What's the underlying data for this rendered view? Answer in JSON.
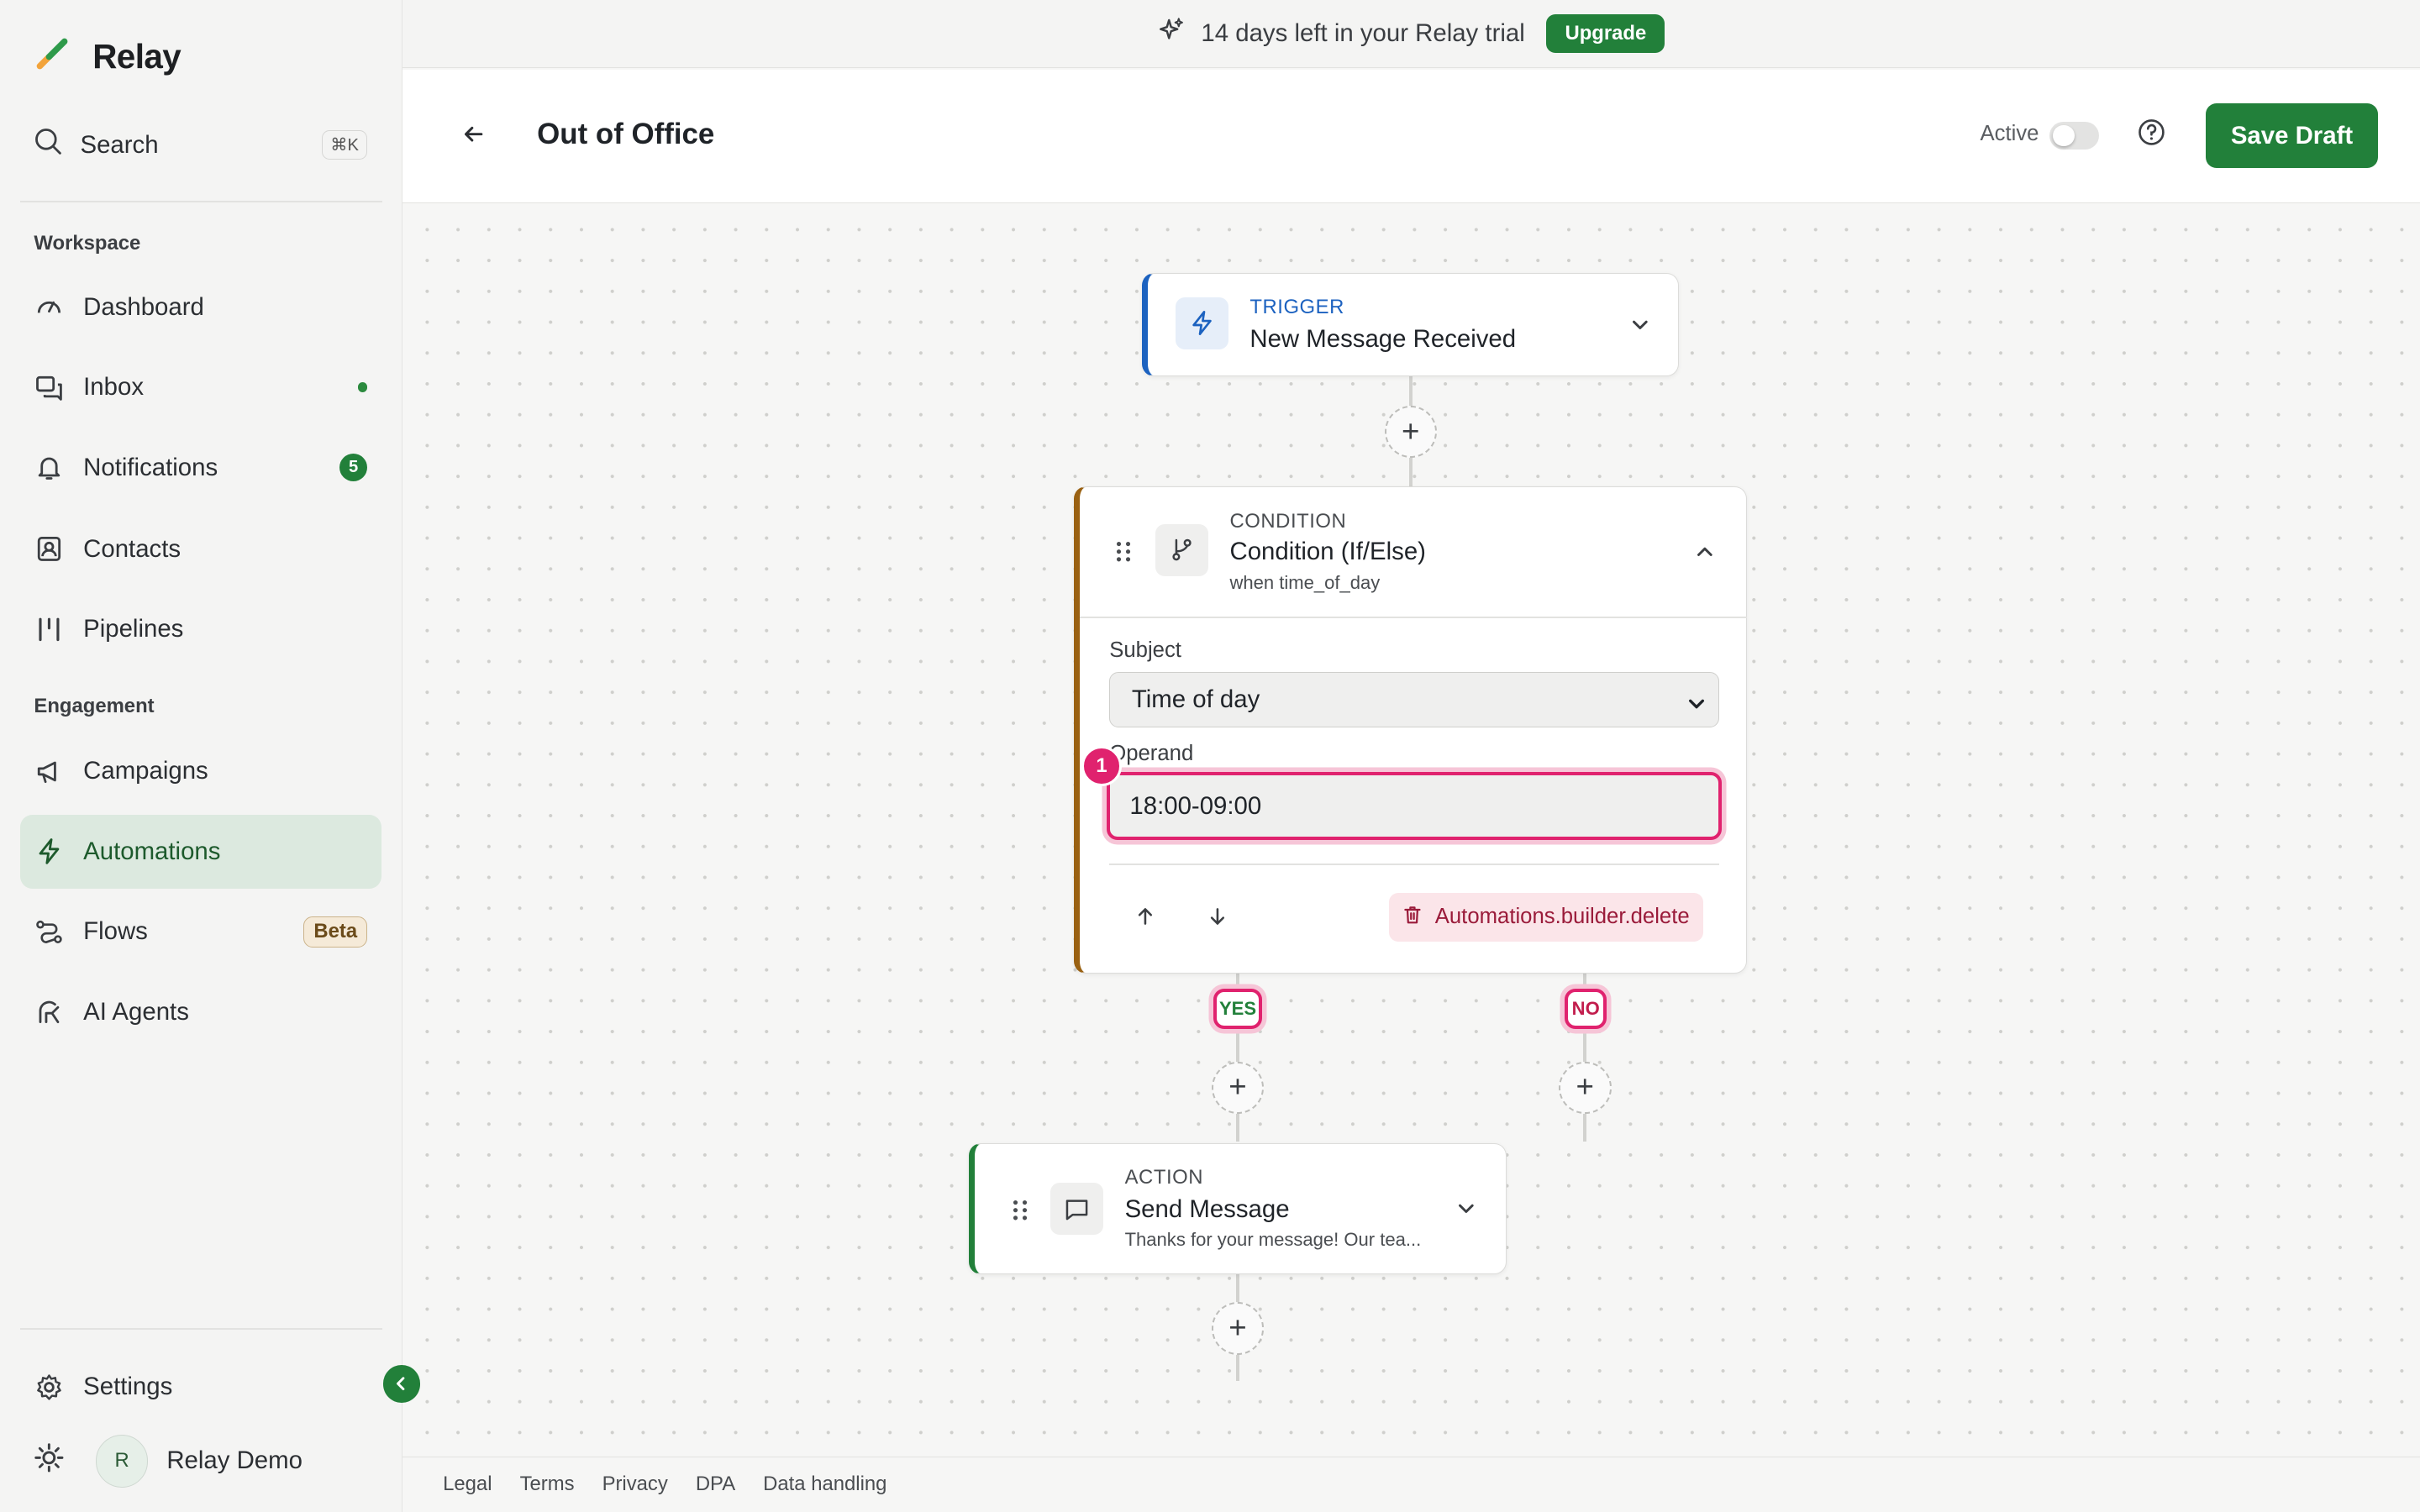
{
  "app": {
    "name": "Relay"
  },
  "banner": {
    "text": "14 days left in your Relay trial",
    "upgrade_label": "Upgrade"
  },
  "sidebar": {
    "search_label": "Search",
    "search_shortcut": "⌘K",
    "sections": {
      "workspace": "Workspace",
      "engagement": "Engagement"
    },
    "items": [
      {
        "label": "Dashboard",
        "icon": "dashboard-icon"
      },
      {
        "label": "Inbox",
        "icon": "inbox-icon",
        "unread_dot": true
      },
      {
        "label": "Notifications",
        "icon": "bell-icon",
        "badge": "5"
      },
      {
        "label": "Contacts",
        "icon": "contacts-icon"
      },
      {
        "label": "Pipelines",
        "icon": "pipelines-icon"
      },
      {
        "label": "Campaigns",
        "icon": "megaphone-icon"
      },
      {
        "label": "Automations",
        "icon": "bolt-icon",
        "active": true
      },
      {
        "label": "Flows",
        "icon": "flows-icon",
        "badge": "Beta"
      },
      {
        "label": "AI Agents",
        "icon": "ai-agent-icon"
      }
    ],
    "settings_label": "Settings",
    "user": {
      "initial": "R",
      "name": "Relay Demo"
    }
  },
  "header": {
    "title": "Out of Office",
    "active_label": "Active",
    "active": false,
    "save_label": "Save Draft"
  },
  "canvas": {
    "trigger": {
      "kind": "TRIGGER",
      "title": "New Message Received"
    },
    "condition": {
      "kind": "CONDITION",
      "title": "Condition (If/Else)",
      "subtitle": "when time_of_day",
      "subject_label": "Subject",
      "subject_value": "Time of day",
      "operand_label": "Operand",
      "operand_value": "18:00-09:00",
      "marker": "1",
      "delete_label": "Automations.builder.delete",
      "branches": {
        "yes": "YES",
        "no": "NO"
      }
    },
    "action": {
      "kind": "ACTION",
      "title": "Send Message",
      "subtitle": "Thanks for your message! Our tea..."
    },
    "add_symbol": "+"
  },
  "footer": {
    "links": [
      "Legal",
      "Terms",
      "Privacy",
      "DPA",
      "Data handling"
    ]
  },
  "colors": {
    "brand_green": "#22803a",
    "trigger_blue": "#1c62c0",
    "condition_brown": "#9a6112",
    "highlight_pink": "#e0226e"
  }
}
